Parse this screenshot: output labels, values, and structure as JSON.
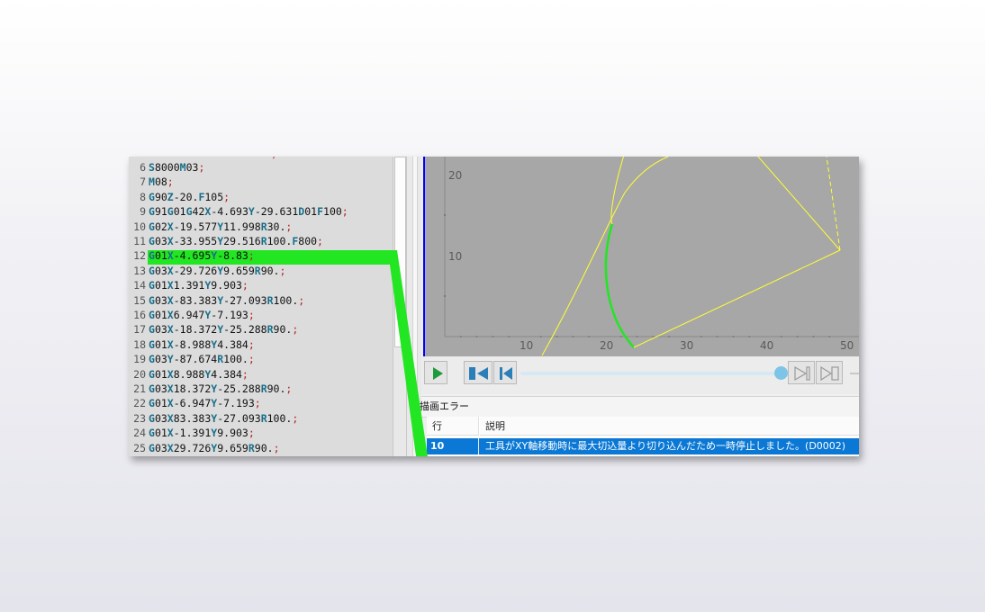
{
  "editor": {
    "lines": [
      {
        "num": "6",
        "parts": [
          [
            "kw",
            "S"
          ],
          [
            "t",
            "8000"
          ],
          [
            "kw",
            "M"
          ],
          [
            "t",
            "03"
          ],
          [
            "sc",
            ";"
          ]
        ]
      },
      {
        "num": "7",
        "parts": [
          [
            "kw",
            "M"
          ],
          [
            "t",
            "08"
          ],
          [
            "sc",
            ";"
          ]
        ]
      },
      {
        "num": "8",
        "parts": [
          [
            "kw",
            "G"
          ],
          [
            "t",
            "90"
          ],
          [
            "kw",
            "Z"
          ],
          [
            "t",
            "-20."
          ],
          [
            "kw",
            "F"
          ],
          [
            "t",
            "105"
          ],
          [
            "sc",
            ";"
          ]
        ]
      },
      {
        "num": "9",
        "parts": [
          [
            "kw",
            "G"
          ],
          [
            "t",
            "91"
          ],
          [
            "kw",
            "G"
          ],
          [
            "t",
            "01"
          ],
          [
            "kw",
            "G"
          ],
          [
            "t",
            "42"
          ],
          [
            "kw",
            "X"
          ],
          [
            "t",
            "-4.693"
          ],
          [
            "kw",
            "Y"
          ],
          [
            "t",
            "-29.631"
          ],
          [
            "kw",
            "D"
          ],
          [
            "t",
            "01"
          ],
          [
            "kw",
            "F"
          ],
          [
            "t",
            "100"
          ],
          [
            "sc",
            ";"
          ]
        ]
      },
      {
        "num": "10",
        "parts": [
          [
            "kw",
            "G"
          ],
          [
            "t",
            "02"
          ],
          [
            "kw",
            "X"
          ],
          [
            "t",
            "-19.577"
          ],
          [
            "kw",
            "Y"
          ],
          [
            "t",
            "11.998"
          ],
          [
            "kw",
            "R"
          ],
          [
            "t",
            "30."
          ],
          [
            "sc",
            ";"
          ]
        ]
      },
      {
        "num": "11",
        "parts": [
          [
            "kw",
            "G"
          ],
          [
            "t",
            "03"
          ],
          [
            "kw",
            "X"
          ],
          [
            "t",
            "-33.955"
          ],
          [
            "kw",
            "Y"
          ],
          [
            "t",
            "29.516"
          ],
          [
            "kw",
            "R"
          ],
          [
            "t",
            "100."
          ],
          [
            "kw",
            "F"
          ],
          [
            "t",
            "800"
          ],
          [
            "sc",
            ";"
          ]
        ]
      },
      {
        "num": "12",
        "parts": [
          [
            "kw",
            "G"
          ],
          [
            "t",
            "01"
          ],
          [
            "kw",
            "X"
          ],
          [
            "t",
            "-4.695"
          ],
          [
            "kw",
            "Y"
          ],
          [
            "t",
            "-8.83"
          ],
          [
            "sc",
            ";"
          ]
        ]
      },
      {
        "num": "13",
        "parts": [
          [
            "kw",
            "G"
          ],
          [
            "t",
            "03"
          ],
          [
            "kw",
            "X"
          ],
          [
            "t",
            "-29.726"
          ],
          [
            "kw",
            "Y"
          ],
          [
            "t",
            "9.659"
          ],
          [
            "kw",
            "R"
          ],
          [
            "t",
            "90."
          ],
          [
            "sc",
            ";"
          ]
        ]
      },
      {
        "num": "14",
        "parts": [
          [
            "kw",
            "G"
          ],
          [
            "t",
            "01"
          ],
          [
            "kw",
            "X"
          ],
          [
            "t",
            "1.391"
          ],
          [
            "kw",
            "Y"
          ],
          [
            "t",
            "9.903"
          ],
          [
            "sc",
            ";"
          ]
        ]
      },
      {
        "num": "15",
        "parts": [
          [
            "kw",
            "G"
          ],
          [
            "t",
            "03"
          ],
          [
            "kw",
            "X"
          ],
          [
            "t",
            "-83.383"
          ],
          [
            "kw",
            "Y"
          ],
          [
            "t",
            "-27.093"
          ],
          [
            "kw",
            "R"
          ],
          [
            "t",
            "100."
          ],
          [
            "sc",
            ";"
          ]
        ]
      },
      {
        "num": "16",
        "parts": [
          [
            "kw",
            "G"
          ],
          [
            "t",
            "01"
          ],
          [
            "kw",
            "X"
          ],
          [
            "t",
            "6.947"
          ],
          [
            "kw",
            "Y"
          ],
          [
            "t",
            "-7.193"
          ],
          [
            "sc",
            ";"
          ]
        ]
      },
      {
        "num": "17",
        "parts": [
          [
            "kw",
            "G"
          ],
          [
            "t",
            "03"
          ],
          [
            "kw",
            "X"
          ],
          [
            "t",
            "-18.372"
          ],
          [
            "kw",
            "Y"
          ],
          [
            "t",
            "-25.288"
          ],
          [
            "kw",
            "R"
          ],
          [
            "t",
            "90."
          ],
          [
            "sc",
            ";"
          ]
        ]
      },
      {
        "num": "18",
        "parts": [
          [
            "kw",
            "G"
          ],
          [
            "t",
            "01"
          ],
          [
            "kw",
            "X"
          ],
          [
            "t",
            "-8.988"
          ],
          [
            "kw",
            "Y"
          ],
          [
            "t",
            "4.384"
          ],
          [
            "sc",
            ";"
          ]
        ]
      },
      {
        "num": "19",
        "parts": [
          [
            "kw",
            "G"
          ],
          [
            "t",
            "03"
          ],
          [
            "kw",
            "Y"
          ],
          [
            "t",
            "-87.674"
          ],
          [
            "kw",
            "R"
          ],
          [
            "t",
            "100."
          ],
          [
            "sc",
            ";"
          ]
        ]
      },
      {
        "num": "20",
        "parts": [
          [
            "kw",
            "G"
          ],
          [
            "t",
            "01"
          ],
          [
            "kw",
            "X"
          ],
          [
            "t",
            "8.988"
          ],
          [
            "kw",
            "Y"
          ],
          [
            "t",
            "4.384"
          ],
          [
            "sc",
            ";"
          ]
        ]
      },
      {
        "num": "21",
        "parts": [
          [
            "kw",
            "G"
          ],
          [
            "t",
            "03"
          ],
          [
            "kw",
            "X"
          ],
          [
            "t",
            "18.372"
          ],
          [
            "kw",
            "Y"
          ],
          [
            "t",
            "-25.288"
          ],
          [
            "kw",
            "R"
          ],
          [
            "t",
            "90."
          ],
          [
            "sc",
            ";"
          ]
        ]
      },
      {
        "num": "22",
        "parts": [
          [
            "kw",
            "G"
          ],
          [
            "t",
            "01"
          ],
          [
            "kw",
            "X"
          ],
          [
            "t",
            "-6.947"
          ],
          [
            "kw",
            "Y"
          ],
          [
            "t",
            "-7.193"
          ],
          [
            "sc",
            ";"
          ]
        ]
      },
      {
        "num": "23",
        "parts": [
          [
            "kw",
            "G"
          ],
          [
            "t",
            "03"
          ],
          [
            "kw",
            "X"
          ],
          [
            "t",
            "83.383"
          ],
          [
            "kw",
            "Y"
          ],
          [
            "t",
            "-27.093"
          ],
          [
            "kw",
            "R"
          ],
          [
            "t",
            "100."
          ],
          [
            "sc",
            ";"
          ]
        ]
      },
      {
        "num": "24",
        "parts": [
          [
            "kw",
            "G"
          ],
          [
            "t",
            "01"
          ],
          [
            "kw",
            "X"
          ],
          [
            "t",
            "-1.391"
          ],
          [
            "kw",
            "Y"
          ],
          [
            "t",
            "9.903"
          ],
          [
            "sc",
            ";"
          ]
        ]
      },
      {
        "num": "25",
        "parts": [
          [
            "kw",
            "G"
          ],
          [
            "t",
            "03"
          ],
          [
            "kw",
            "X"
          ],
          [
            "t",
            "29.726"
          ],
          [
            "kw",
            "Y"
          ],
          [
            "t",
            "9.659"
          ],
          [
            "kw",
            "R"
          ],
          [
            "t",
            "90."
          ],
          [
            "sc",
            ";"
          ]
        ]
      }
    ],
    "highlighted_line": "12"
  },
  "plot": {
    "x_ticks": [
      "10",
      "20",
      "30",
      "40",
      "50"
    ],
    "y_ticks": [
      "10",
      "20"
    ],
    "path_color": "#ffff33",
    "highlight_color": "#22e622"
  },
  "controls": {
    "play_icon": "play-icon",
    "rewind_icon": "skip-to-start-icon",
    "step_back_icon": "step-back-icon",
    "step_forward_icon": "step-forward-icon",
    "skip_end_icon": "skip-to-end-icon",
    "slider_position": 0.97
  },
  "errors": {
    "title": "描画エラー",
    "columns": [
      "行",
      "説明"
    ],
    "rows": [
      {
        "line": "10",
        "description": "工具がXY軸移動時に最大切込量より切り込んだため一時停止しました。(D0002)"
      }
    ]
  },
  "colors": {
    "accent_blue": "#0a78d4",
    "highlight_green": "#22e622"
  }
}
